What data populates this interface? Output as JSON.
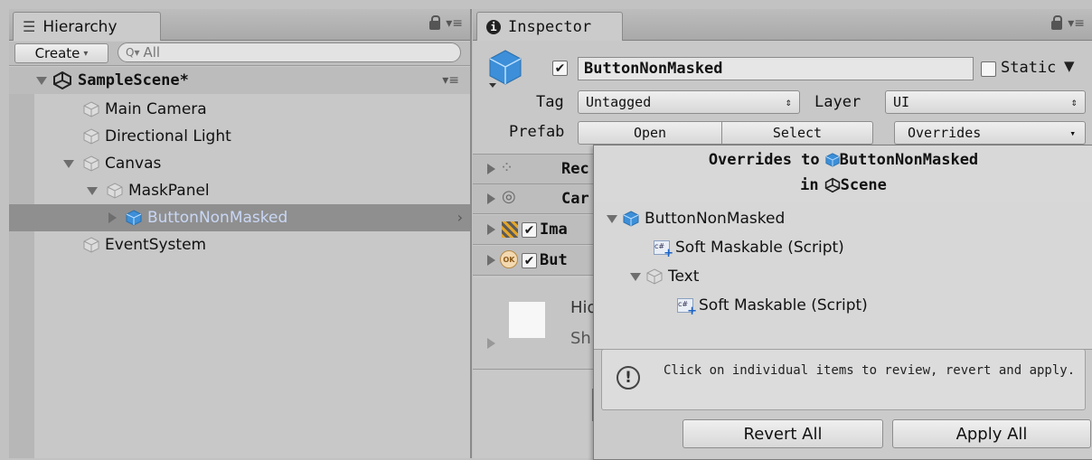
{
  "hierarchy": {
    "tab_label": "Hierarchy",
    "create_label": "Create",
    "search_placeholder": "All",
    "scene_name": "SampleScene*",
    "items": [
      {
        "label": "Main Camera"
      },
      {
        "label": "Directional Light"
      },
      {
        "label": "Canvas"
      },
      {
        "label": "MaskPanel"
      },
      {
        "label": "ButtonNonMasked"
      },
      {
        "label": "EventSystem"
      }
    ]
  },
  "inspector": {
    "tab_label": "Inspector",
    "object_name": "ButtonNonMasked",
    "static_label": "Static",
    "tag_label": "Tag",
    "tag_value": "Untagged",
    "layer_label": "Layer",
    "layer_value": "UI",
    "prefab_label": "Prefab",
    "prefab_open": "Open",
    "prefab_select": "Select",
    "prefab_overrides": "Overrides",
    "components": [
      {
        "label": "Rec"
      },
      {
        "label": "Car"
      },
      {
        "label": "Ima"
      },
      {
        "label": "But"
      }
    ],
    "material_preview": {
      "line1": "Hid",
      "line2": "Sh"
    }
  },
  "overrides_popup": {
    "title_line1": "Overrides to",
    "title_object": "ButtonNonMasked",
    "title_line2_prefix": "in",
    "title_scene": "Scene",
    "tree": {
      "root": "ButtonNonMasked",
      "root_component": "Soft Maskable (Script)",
      "child": "Text",
      "child_component": "Soft Maskable (Script)"
    },
    "help_text": "Click on individual items to review, revert and apply.",
    "revert_all": "Revert All",
    "apply_all": "Apply All"
  },
  "colors": {
    "selection_row": "#8f8f8f",
    "selected_text": "#c9d7f5",
    "cube_blue": "#3c8fd8"
  }
}
